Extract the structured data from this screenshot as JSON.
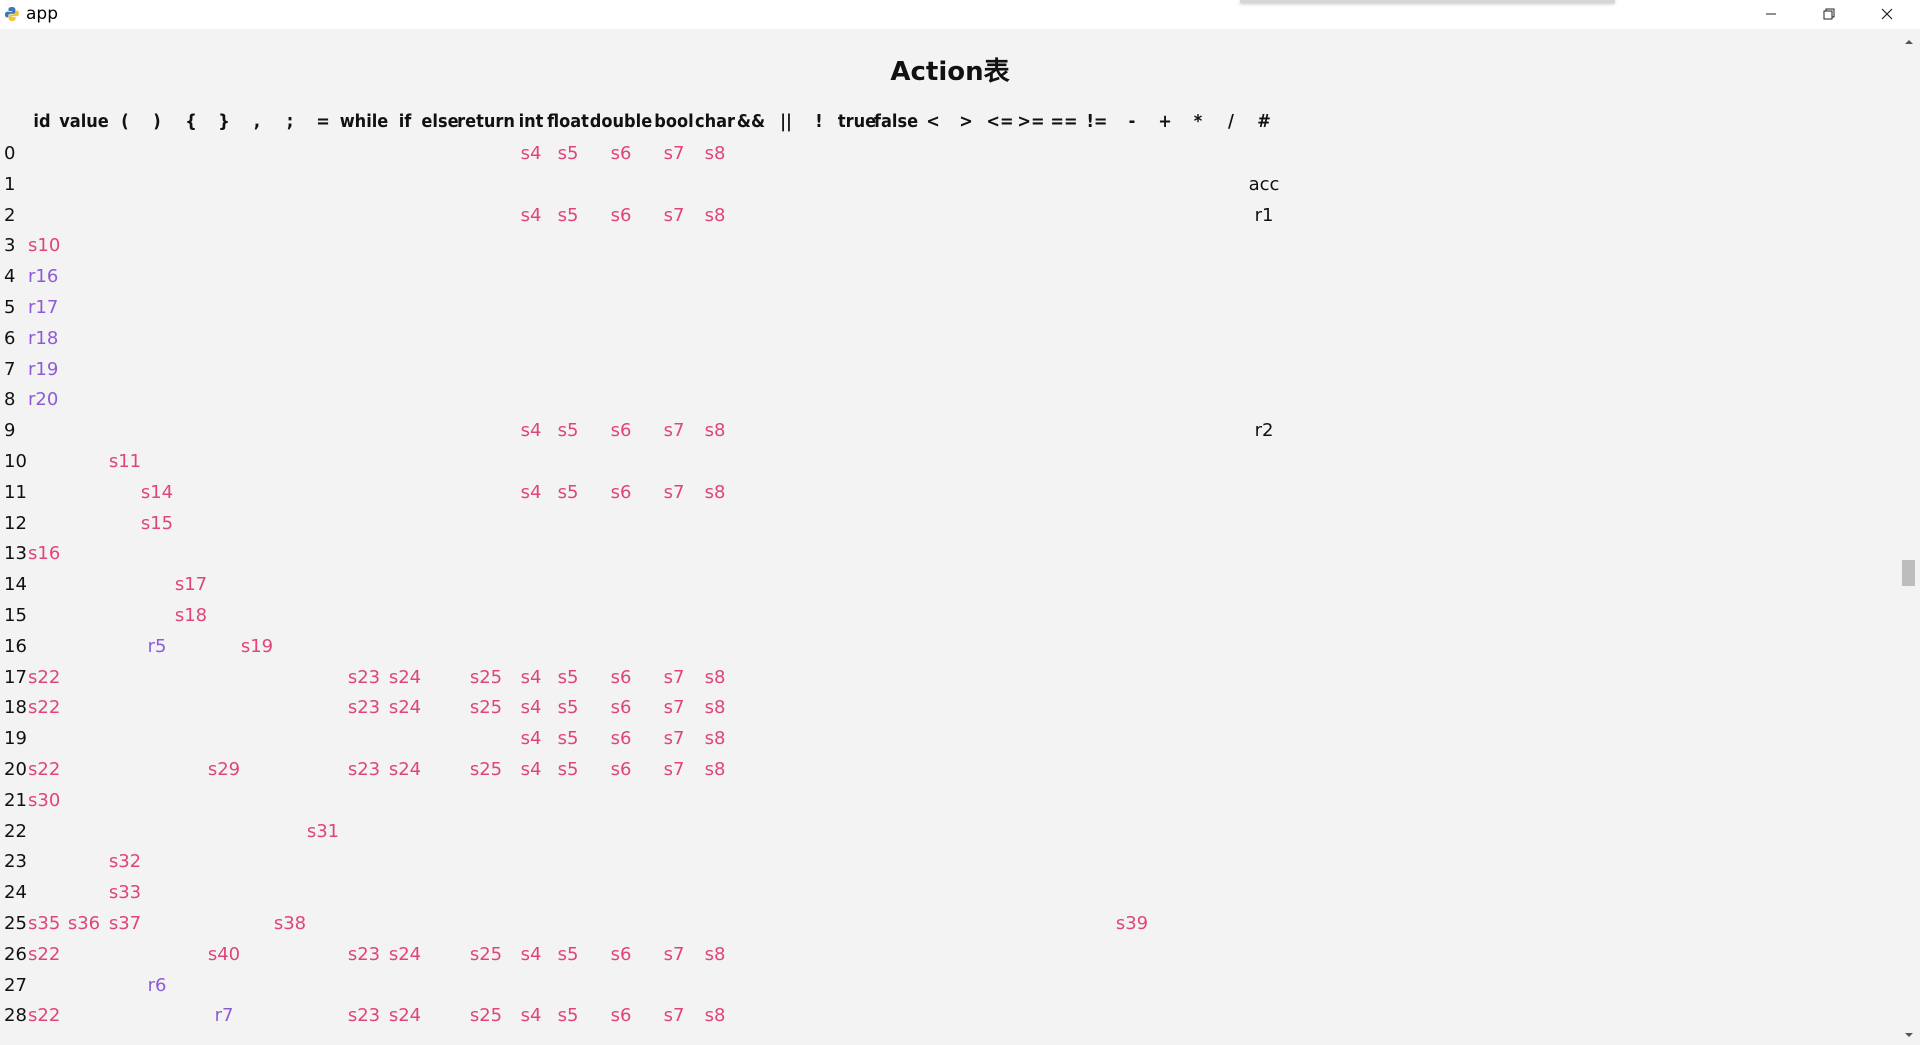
{
  "window": {
    "title": "app",
    "icon": "python-icon"
  },
  "page": {
    "title": "Action表"
  },
  "colors": {
    "shift": "#e0457a",
    "reduce": "#8e5bd6",
    "plain": "#111111"
  },
  "table": {
    "columns": [
      "id",
      "value",
      "(",
      ")",
      "{",
      "}",
      ",",
      ";",
      "=",
      "while",
      "if",
      "else",
      "return",
      "int",
      "float",
      "double",
      "bool",
      "char",
      "&&",
      "||",
      "!",
      "true",
      "false",
      "<",
      ">",
      "<=",
      ">=",
      "==",
      "!=",
      "-",
      "+",
      "*",
      "/",
      "#"
    ],
    "rows": [
      {
        "state": "0",
        "cells": [
          {
            "col": "int",
            "v": "s4"
          },
          {
            "col": "float",
            "v": "s5"
          },
          {
            "col": "double",
            "v": "s6"
          },
          {
            "col": "bool",
            "v": "s7"
          },
          {
            "col": "char",
            "v": "s8"
          }
        ]
      },
      {
        "state": "1",
        "cells": [
          {
            "col": "#",
            "v": "acc"
          }
        ]
      },
      {
        "state": "2",
        "cells": [
          {
            "col": "int",
            "v": "s4"
          },
          {
            "col": "float",
            "v": "s5"
          },
          {
            "col": "double",
            "v": "s6"
          },
          {
            "col": "bool",
            "v": "s7"
          },
          {
            "col": "char",
            "v": "s8"
          },
          {
            "col": "#",
            "v": "r1"
          }
        ]
      },
      {
        "state": "3",
        "cells": [
          {
            "col": "id",
            "v": "s10"
          }
        ]
      },
      {
        "state": "4",
        "cells": [
          {
            "col": "id",
            "v": "r16"
          }
        ]
      },
      {
        "state": "5",
        "cells": [
          {
            "col": "id",
            "v": "r17"
          }
        ]
      },
      {
        "state": "6",
        "cells": [
          {
            "col": "id",
            "v": "r18"
          }
        ]
      },
      {
        "state": "7",
        "cells": [
          {
            "col": "id",
            "v": "r19"
          }
        ]
      },
      {
        "state": "8",
        "cells": [
          {
            "col": "id",
            "v": "r20"
          }
        ]
      },
      {
        "state": "9",
        "cells": [
          {
            "col": "int",
            "v": "s4"
          },
          {
            "col": "float",
            "v": "s5"
          },
          {
            "col": "double",
            "v": "s6"
          },
          {
            "col": "bool",
            "v": "s7"
          },
          {
            "col": "char",
            "v": "s8"
          },
          {
            "col": "#",
            "v": "r2"
          }
        ]
      },
      {
        "state": "10",
        "cells": [
          {
            "col": "(",
            "v": "s11"
          }
        ]
      },
      {
        "state": "11",
        "cells": [
          {
            "col": ")",
            "v": "s14"
          },
          {
            "col": "int",
            "v": "s4"
          },
          {
            "col": "float",
            "v": "s5"
          },
          {
            "col": "double",
            "v": "s6"
          },
          {
            "col": "bool",
            "v": "s7"
          },
          {
            "col": "char",
            "v": "s8"
          }
        ]
      },
      {
        "state": "12",
        "cells": [
          {
            "col": ")",
            "v": "s15"
          }
        ]
      },
      {
        "state": "13",
        "cells": [
          {
            "col": "id",
            "v": "s16"
          }
        ]
      },
      {
        "state": "14",
        "cells": [
          {
            "col": "{",
            "v": "s17"
          }
        ]
      },
      {
        "state": "15",
        "cells": [
          {
            "col": "{",
            "v": "s18"
          }
        ]
      },
      {
        "state": "16",
        "cells": [
          {
            "col": ")",
            "v": "r5"
          },
          {
            "col": ",",
            "v": "s19"
          }
        ]
      },
      {
        "state": "17",
        "cells": [
          {
            "col": "id",
            "v": "s22"
          },
          {
            "col": "while",
            "v": "s23"
          },
          {
            "col": "if",
            "v": "s24"
          },
          {
            "col": "return",
            "v": "s25"
          },
          {
            "col": "int",
            "v": "s4"
          },
          {
            "col": "float",
            "v": "s5"
          },
          {
            "col": "double",
            "v": "s6"
          },
          {
            "col": "bool",
            "v": "s7"
          },
          {
            "col": "char",
            "v": "s8"
          }
        ]
      },
      {
        "state": "18",
        "cells": [
          {
            "col": "id",
            "v": "s22"
          },
          {
            "col": "while",
            "v": "s23"
          },
          {
            "col": "if",
            "v": "s24"
          },
          {
            "col": "return",
            "v": "s25"
          },
          {
            "col": "int",
            "v": "s4"
          },
          {
            "col": "float",
            "v": "s5"
          },
          {
            "col": "double",
            "v": "s6"
          },
          {
            "col": "bool",
            "v": "s7"
          },
          {
            "col": "char",
            "v": "s8"
          }
        ]
      },
      {
        "state": "19",
        "cells": [
          {
            "col": "int",
            "v": "s4"
          },
          {
            "col": "float",
            "v": "s5"
          },
          {
            "col": "double",
            "v": "s6"
          },
          {
            "col": "bool",
            "v": "s7"
          },
          {
            "col": "char",
            "v": "s8"
          }
        ]
      },
      {
        "state": "20",
        "cells": [
          {
            "col": "id",
            "v": "s22"
          },
          {
            "col": "}",
            "v": "s29"
          },
          {
            "col": "while",
            "v": "s23"
          },
          {
            "col": "if",
            "v": "s24"
          },
          {
            "col": "return",
            "v": "s25"
          },
          {
            "col": "int",
            "v": "s4"
          },
          {
            "col": "float",
            "v": "s5"
          },
          {
            "col": "double",
            "v": "s6"
          },
          {
            "col": "bool",
            "v": "s7"
          },
          {
            "col": "char",
            "v": "s8"
          }
        ]
      },
      {
        "state": "21",
        "cells": [
          {
            "col": "id",
            "v": "s30"
          }
        ]
      },
      {
        "state": "22",
        "cells": [
          {
            "col": "=",
            "v": "s31"
          }
        ]
      },
      {
        "state": "23",
        "cells": [
          {
            "col": "(",
            "v": "s32"
          }
        ]
      },
      {
        "state": "24",
        "cells": [
          {
            "col": "(",
            "v": "s33"
          }
        ]
      },
      {
        "state": "25",
        "cells": [
          {
            "col": "id",
            "v": "s35"
          },
          {
            "col": "value",
            "v": "s36"
          },
          {
            "col": "(",
            "v": "s37"
          },
          {
            "col": ";",
            "v": "s38"
          },
          {
            "col": "-",
            "v": "s39"
          }
        ]
      },
      {
        "state": "26",
        "cells": [
          {
            "col": "id",
            "v": "s22"
          },
          {
            "col": "}",
            "v": "s40"
          },
          {
            "col": "while",
            "v": "s23"
          },
          {
            "col": "if",
            "v": "s24"
          },
          {
            "col": "return",
            "v": "s25"
          },
          {
            "col": "int",
            "v": "s4"
          },
          {
            "col": "float",
            "v": "s5"
          },
          {
            "col": "double",
            "v": "s6"
          },
          {
            "col": "bool",
            "v": "s7"
          },
          {
            "col": "char",
            "v": "s8"
          }
        ]
      },
      {
        "state": "27",
        "cells": [
          {
            "col": ")",
            "v": "r6"
          }
        ]
      },
      {
        "state": "28",
        "cells": [
          {
            "col": "id",
            "v": "s22"
          },
          {
            "col": "}",
            "v": "r7"
          },
          {
            "col": "while",
            "v": "s23"
          },
          {
            "col": "if",
            "v": "s24"
          },
          {
            "col": "return",
            "v": "s25"
          },
          {
            "col": "int",
            "v": "s4"
          },
          {
            "col": "float",
            "v": "s5"
          },
          {
            "col": "double",
            "v": "s6"
          },
          {
            "col": "bool",
            "v": "s7"
          },
          {
            "col": "char",
            "v": "s8"
          }
        ]
      }
    ]
  }
}
